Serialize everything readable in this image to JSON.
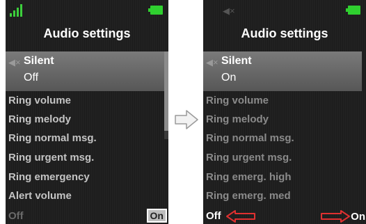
{
  "left_screen": {
    "title": "Audio settings",
    "selected": {
      "label": "Silent",
      "value": "Off"
    },
    "items": [
      "Ring volume",
      "Ring melody",
      "Ring normal msg.",
      "Ring urgent msg.",
      "Ring emergency",
      "Alert volume"
    ],
    "softkey_left": "Off",
    "softkey_right": "On",
    "icons": [
      "signal-icon",
      "battery-icon",
      "speaker-icon"
    ]
  },
  "right_screen": {
    "title": "Audio settings",
    "selected": {
      "label": "Silent",
      "value": "On"
    },
    "items": [
      "Ring volume",
      "Ring melody",
      "Ring normal msg.",
      "Ring urgent msg.",
      "Ring emerg. high",
      "Ring emerg. med"
    ],
    "softkey_left": "Off",
    "softkey_right": "On",
    "icons": [
      "mute-icon",
      "battery-icon",
      "speaker-icon"
    ]
  },
  "colors": {
    "highlight": "#6a6a6a",
    "battery": "#2fd02f",
    "signal": "#3ccf3c",
    "annotation_arrow": "#e03030"
  }
}
